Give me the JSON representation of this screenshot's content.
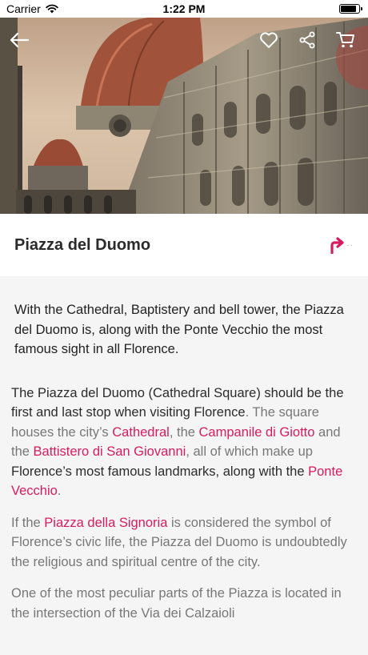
{
  "status_bar": {
    "carrier": "Carrier",
    "time": "1:22 PM",
    "battery_level": 0.9
  },
  "place": {
    "title": "Piazza del Duomo"
  },
  "intro": "With the Cathedral, Baptistery and bell tower, the Piazza del Duomo is, along with the Ponte Vecchio the most famous sight in all Florence.",
  "para1": {
    "s1": "The Piazza del Duomo (Cathedral Square) should be the first and last stop when visiting Florence",
    "t1": ". The square houses the city’s ",
    "l1": "Cathedral",
    "t2": ", the ",
    "l2": "Campanile di Giotto",
    "t3": " and the ",
    "l3": "Battistero di San Giovanni",
    "t4": ", all of which make up ",
    "s2": "Florence’s most famous landmarks, along with the ",
    "l4": "Ponte Vecchio",
    "t5": "."
  },
  "para2": {
    "t1": "If the ",
    "l1": "Piazza della Signoria",
    "t2": " is considered the symbol of Florence’s civic life, the Piazza del Duomo is undoubtedly the religious and spiritual centre of the city."
  },
  "para3": {
    "t1": "One of the most peculiar parts of the Piazza is located in the intersection of the Via dei Calzaioli"
  },
  "icons": {
    "back": "arrow-left-icon",
    "favorite": "heart-icon",
    "share": "share-icon",
    "cart": "cart-icon",
    "directions": "directions-icon"
  },
  "colors": {
    "accent": "#d81b60",
    "background": "#f5f5f5"
  }
}
